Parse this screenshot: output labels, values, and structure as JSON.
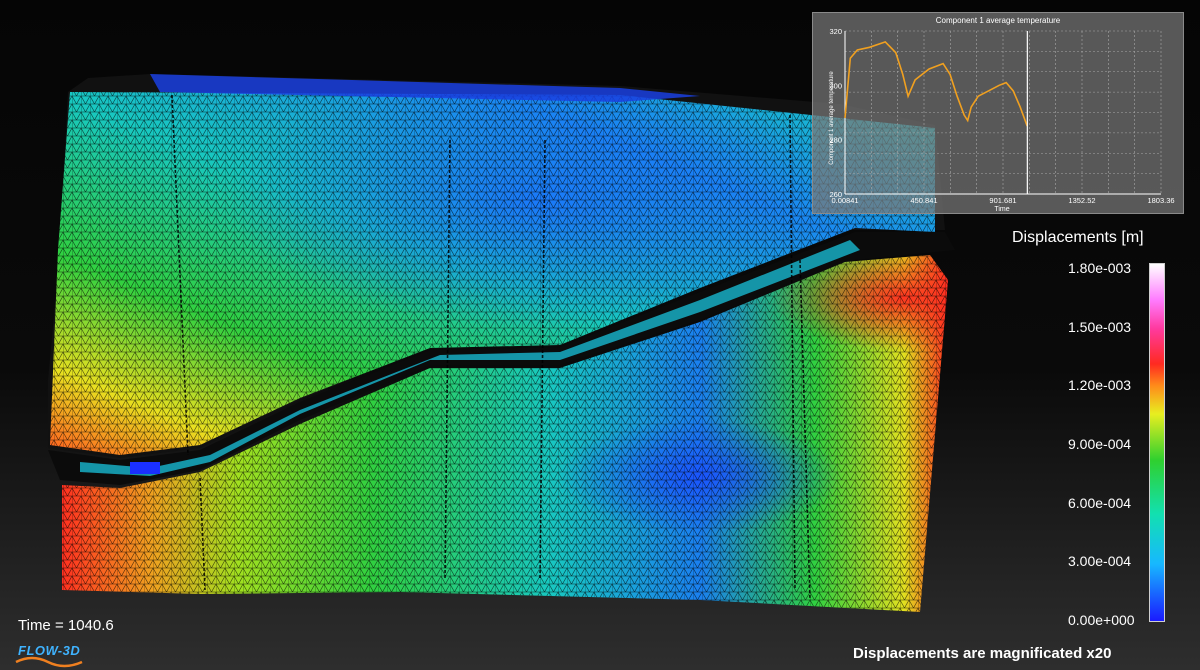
{
  "scene": {
    "time_readout": "Time = 1040.6",
    "magnification_note": "Displacements are magnificated x20",
    "logo_text": "FLOW-3D"
  },
  "legend": {
    "title": "Displacements [m]",
    "labels": [
      "1.80e-003",
      "1.50e-003",
      "1.20e-003",
      "9.00e-004",
      "6.00e-004",
      "3.00e-004",
      "0.00e+000"
    ],
    "colors": [
      "#1a1aff",
      "#17b8ff",
      "#2fd02f",
      "#e8ee20",
      "#ff2a20",
      "#ff7cff",
      "#ffffff"
    ]
  },
  "chart_data": {
    "type": "line",
    "title": "Component 1 average temperature",
    "xlabel": "Time",
    "ylabel": "Component 1 average temperature",
    "xlim": [
      0.00841,
      1803.36
    ],
    "ylim": [
      260,
      320
    ],
    "x_tick_labels": [
      "0.00841",
      "450.841",
      "901.681",
      "1352.52",
      "1803.36"
    ],
    "x_ticks": [
      0.00841,
      450.841,
      901.681,
      1352.52,
      1803.36
    ],
    "y_tick_labels": [
      "260",
      "280",
      "300",
      "320"
    ],
    "y_ticks": [
      260,
      280,
      300,
      320
    ],
    "grid": true,
    "series_color": "#f0a020",
    "cursor_x": 1040.6,
    "series": [
      {
        "x": [
          0,
          30,
          70,
          140,
          230,
          290,
          330,
          360,
          400,
          480,
          560,
          600,
          640,
          680,
          700,
          720,
          760,
          820,
          880,
          920,
          960,
          1000,
          1040
        ],
        "y": [
          288,
          310,
          313,
          314,
          316,
          312,
          304,
          296,
          302,
          306,
          308,
          304,
          296,
          289,
          287,
          292,
          296,
          298,
          300,
          301,
          298,
          292,
          285
        ]
      }
    ]
  }
}
